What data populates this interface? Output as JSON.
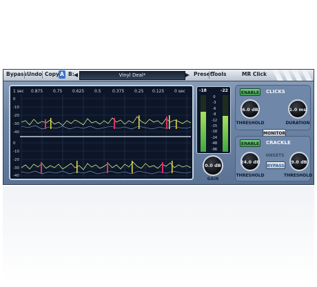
{
  "toolbar": {
    "bypass_label": "Bypass",
    "undo_label": "Undo",
    "copy_label": "Copy",
    "a_label": "A",
    "b_label": "B:",
    "preset_name": "Vinyl Deal*",
    "preset_label": "Preset",
    "tools_label": "Tools",
    "plugin_title": "MR Click"
  },
  "display": {
    "time_ticks": [
      "1 sec",
      "0.875",
      "0.75",
      "0.625",
      "0.5",
      "0.375",
      "0.25",
      "0.125",
      "0 sec"
    ],
    "db_ticks_top": [
      "0",
      "-10",
      "-20",
      "-30",
      "-40"
    ],
    "db_ticks_bottom": [
      "0",
      "-10",
      "-20",
      "-30",
      "-40"
    ]
  },
  "meter": {
    "left_top": "-18",
    "right_top": "-22",
    "scale": [
      "0",
      "-3",
      "-6",
      "-9",
      "-12",
      "-15",
      "-18",
      "-24",
      "-48",
      "-96"
    ]
  },
  "gain": {
    "value": "0.0 dB",
    "label": "GAIN"
  },
  "clicks": {
    "enable_label": "ENABLE",
    "title": "CLICKS",
    "threshold_value": "6.0 dB",
    "threshold_label": "THRESHOLD",
    "duration_value": "1.0 ms",
    "duration_label": "DURATION"
  },
  "monitor_label": "MONITOR",
  "crackle": {
    "enable_label": "ENABLE",
    "title": "CRACKLE",
    "threshold_value": "24.0 dB",
    "threshold_label": "THRESHOLD",
    "onsets_label": "ONSETS",
    "bypass_label": "BYPASS",
    "threshold2_value": "9.0 dB",
    "threshold2_label": "THRESHOLD"
  }
}
